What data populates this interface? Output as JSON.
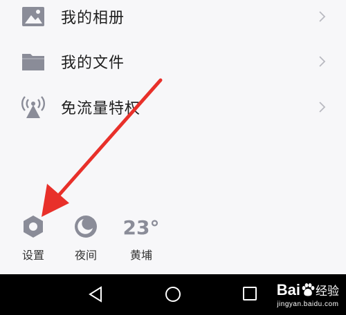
{
  "menu": {
    "items": [
      {
        "label": "我的相册",
        "icon": "photo-album-icon"
      },
      {
        "label": "我的文件",
        "icon": "folder-icon"
      },
      {
        "label": "免流量特权",
        "icon": "signal-tower-icon"
      }
    ]
  },
  "tools": {
    "settings": {
      "label": "设置",
      "icon": "gear-icon"
    },
    "night": {
      "label": "夜间",
      "icon": "moon-icon"
    },
    "weather": {
      "temperature": "23°",
      "location": "黄埔"
    }
  },
  "annotation": {
    "icon": "red-arrow-icon",
    "color": "#e8302a"
  },
  "system_nav": {
    "back_icon": "back-triangle-icon",
    "home_icon": "home-circle-icon",
    "recent_icon": "recent-square-icon"
  },
  "watermark": {
    "brand_prefix": "Bai",
    "brand_suffix": "经验",
    "url": "jingyan.baidu.com"
  },
  "colors": {
    "icon_gray": "#8a8c98",
    "background": "#f7f7f9",
    "navbar": "#000000"
  }
}
